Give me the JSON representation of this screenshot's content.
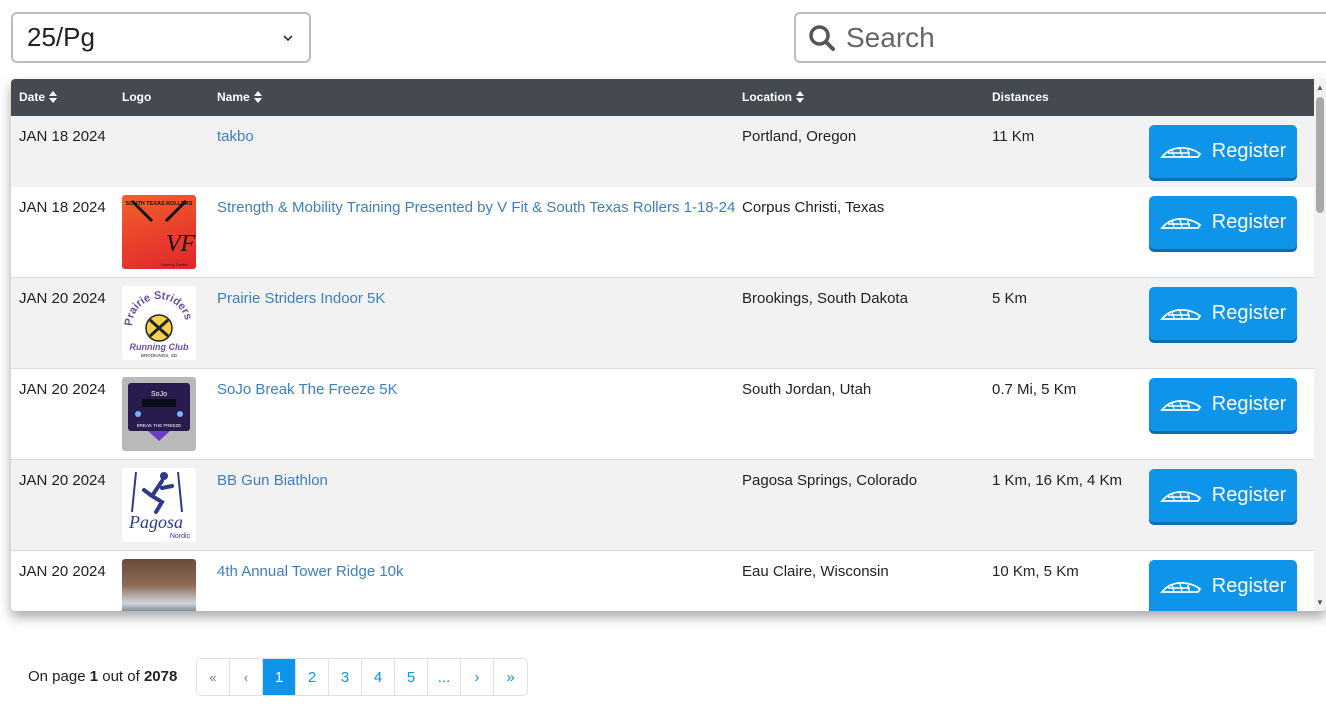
{
  "controls": {
    "per_page_value": "25/Pg",
    "search_placeholder": "Search"
  },
  "table": {
    "headers": {
      "date": "Date",
      "logo": "Logo",
      "name": "Name",
      "location": "Location",
      "distances": "Distances"
    },
    "register_label": "Register",
    "rows": [
      {
        "date": "JAN 18 2024",
        "name": "takbo",
        "location": "Portland, Oregon",
        "distances": "11 Km",
        "logo": "none"
      },
      {
        "date": "JAN 18 2024",
        "name": "Strength & Mobility Training Presented by V Fit & South Texas Rollers 1-18-24",
        "location": "Corpus Christi, Texas",
        "distances": "",
        "logo": "south-texas-rollers-logo",
        "logo_text": "SOUTH TEXAS ROLLERS",
        "logo_subtext": "Training Center"
      },
      {
        "date": "JAN 20 2024",
        "name": "Prairie Striders Indoor 5K",
        "location": "Brookings, South Dakota",
        "distances": "5 Km",
        "logo": "prairie-striders-logo",
        "logo_text": "Prairie Striders",
        "logo_subtext": "Running Club",
        "logo_city": "BROOKINGS, SD"
      },
      {
        "date": "JAN 20 2024",
        "name": "SoJo Break The Freeze 5K",
        "location": "South Jordan, Utah",
        "distances": "0.7 Mi, 5 Km",
        "logo": "sojo-logo",
        "logo_text": "SoJo",
        "logo_subtext": "BREAK THE FREEZE"
      },
      {
        "date": "JAN 20 2024",
        "name": "BB Gun Biathlon",
        "location": "Pagosa Springs, Colorado",
        "distances": "1 Km, 16 Km, 4 Km",
        "logo": "pagosa-nordic-logo",
        "logo_text": "Pagosa",
        "logo_subtext": "Nordic"
      },
      {
        "date": "JAN 20 2024",
        "name": "4th Annual Tower Ridge 10k",
        "location": "Eau Claire, Wisconsin",
        "distances": "10 Km, 5 Km",
        "logo": "tower-ridge-photo"
      }
    ]
  },
  "pagination": {
    "info_prefix": "On page",
    "current_page": "1",
    "info_middle": "out of",
    "total_pages": "2078",
    "first": "«",
    "prev": "‹",
    "pages": [
      "1",
      "2",
      "3",
      "4",
      "5"
    ],
    "ellipsis": "...",
    "next": "›",
    "last": "»"
  },
  "colors": {
    "accent": "#0e95e9",
    "header_bg": "#454a50",
    "link": "#3d7fc0"
  }
}
